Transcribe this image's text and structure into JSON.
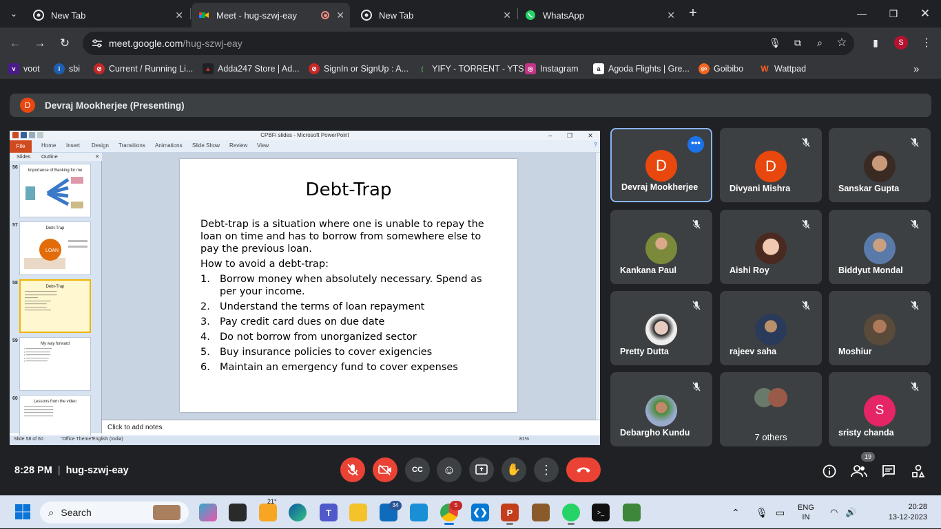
{
  "browser": {
    "tabs": [
      {
        "title": "New Tab",
        "icon": "chrome-icon",
        "active": false
      },
      {
        "title": "Meet - hug-szwj-eay",
        "icon": "meet-icon",
        "active": true,
        "recording": true
      },
      {
        "title": "New Tab",
        "icon": "chrome-icon",
        "active": false
      },
      {
        "title": "WhatsApp",
        "icon": "whatsapp-icon",
        "active": false
      }
    ],
    "url_domain": "meet.google.com",
    "url_path": "/hug-szwj-eay",
    "profile_initial": "S",
    "bookmarks": [
      {
        "label": "voot",
        "color": "#4b1b8c",
        "glyph": "v"
      },
      {
        "label": "sbi",
        "color": "#1e5fb4",
        "glyph": "i"
      },
      {
        "label": "Current / Running Li...",
        "color": "#c62828",
        "glyph": "⊘"
      },
      {
        "label": "Adda247 Store | Ad...",
        "color": "#d32f2f",
        "glyph": "▲"
      },
      {
        "label": "SignIn or SignUp : A...",
        "color": "#c62828",
        "glyph": "⊘"
      },
      {
        "label": "YIFY - TORRENT - YTS",
        "color": "#2e7d32",
        "glyph": "("
      },
      {
        "label": "Instagram",
        "color": "#c13584",
        "glyph": "◎"
      },
      {
        "label": "Agoda Flights | Gre...",
        "color": "#ffffff",
        "glyph": "a"
      },
      {
        "label": "Goibibo",
        "color": "#f26522",
        "glyph": "go"
      },
      {
        "label": "Wattpad",
        "color": "#ff6122",
        "glyph": "W"
      }
    ]
  },
  "meet": {
    "presenter_initial": "D",
    "presenter_label": "Devraj Mookherjee (Presenting)",
    "meeting_time": "8:28 PM",
    "meeting_code": "hug-szwj-eay",
    "people_count": "19",
    "participants": [
      {
        "name": "Devraj Mookherjee",
        "initial": "D",
        "avatar": "letter",
        "color": "#e8470e",
        "active": true
      },
      {
        "name": "Divyani Mishra",
        "initial": "D",
        "avatar": "letter",
        "color": "#e8470e",
        "active": false
      },
      {
        "name": "Sanskar Gupta",
        "avatar": "photo",
        "color": "#5a3a2a"
      },
      {
        "name": "Kankana Paul",
        "avatar": "photo",
        "color": "#6b7a3a"
      },
      {
        "name": "Aishi Roy",
        "avatar": "photo",
        "color": "#c9a08a"
      },
      {
        "name": "Biddyut Mondal",
        "avatar": "photo",
        "color": "#4a6a9a"
      },
      {
        "name": "Pretty Dutta",
        "avatar": "photo",
        "color": "#e0e0e0"
      },
      {
        "name": "rajeev saha",
        "avatar": "photo",
        "color": "#3a4a5a"
      },
      {
        "name": "Moshiur",
        "avatar": "photo",
        "color": "#6a4a3a"
      },
      {
        "name": "Debargho Kundu",
        "avatar": "photo",
        "color": "#4a8a3a"
      },
      {
        "name": "7 others",
        "avatar": "group",
        "color": "#5a5a5a"
      },
      {
        "name": "sristy chanda",
        "initial": "S",
        "avatar": "letter",
        "color": "#e52565"
      }
    ]
  },
  "ppt": {
    "window_title": "CPBFi slides - Microsoft PowerPoint",
    "ribbon_tabs": [
      "File",
      "Home",
      "Insert",
      "Design",
      "Transitions",
      "Animations",
      "Slide Show",
      "Review",
      "View"
    ],
    "pane_tabs": [
      "Slides",
      "Outline"
    ],
    "thumbnails": [
      {
        "num": "56",
        "title": "Importance of Banking for me"
      },
      {
        "num": "57",
        "title": "Debt-Trap"
      },
      {
        "num": "58",
        "title": "Debt-Trap"
      },
      {
        "num": "59",
        "title": "My way forward"
      },
      {
        "num": "60",
        "title": "Lessons from the video"
      }
    ],
    "slide": {
      "title": "Debt-Trap",
      "intro": "Debt-trap is a situation where one is unable to repay the loan on time and has to borrow from somewhere else to pay the previous loan.",
      "subhead": "How to avoid a debt-trap:",
      "items": [
        {
          "n": "1.",
          "text": "Borrow money when absolutely necessary. Spend as per your income."
        },
        {
          "n": "2.",
          "text": "Understand the terms of loan repayment"
        },
        {
          "n": "3.",
          "text": "Pay credit card dues on due date"
        },
        {
          "n": "4.",
          "text": "Do not borrow from unorganized sector"
        },
        {
          "n": "5.",
          "text": "Buy insurance policies to cover exigencies"
        },
        {
          "n": "6.",
          "text": "Maintain an emergency fund to cover expenses"
        }
      ]
    },
    "notes_placeholder": "Click to add notes",
    "status_slide": "Slide 58 of 60",
    "status_theme": "\"Office Theme\"",
    "status_lang": "English (India)",
    "status_zoom": "81%"
  },
  "taskbar": {
    "search_placeholder": "Search",
    "weather_temp": "21°",
    "mail_badge": "34",
    "chrome_badge": "5",
    "lang_top": "ENG",
    "lang_bottom": "IN",
    "time": "20:28",
    "date": "13-12-2023"
  },
  "colors": {
    "meet_bg": "#202124",
    "tile_bg": "#3c4043",
    "hangup": "#ea4335",
    "accent": "#8ab4f8"
  }
}
